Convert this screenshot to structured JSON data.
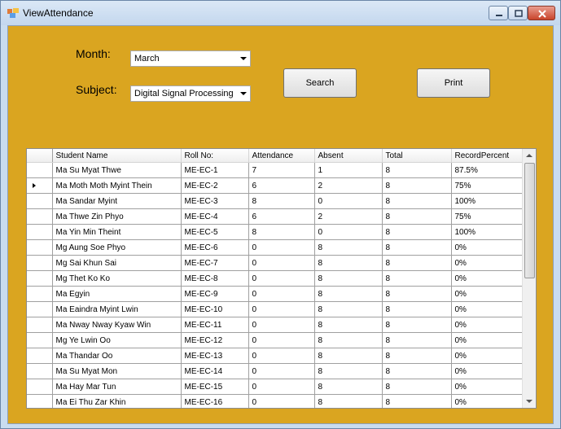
{
  "window": {
    "title": "ViewAttendance"
  },
  "form": {
    "month_label": "Month:",
    "month_value": "March",
    "subject_label": "Subject:",
    "subject_value": "Digital Signal Processing",
    "search_label": "Search",
    "print_label": "Print"
  },
  "grid": {
    "columns": [
      "Student Name",
      "Roll No:",
      "Attendance",
      "Absent",
      "Total",
      "RecordPercent"
    ],
    "rows": [
      [
        "Ma Su Myat Thwe",
        "ME-EC-1",
        "7",
        "1",
        "8",
        "87.5%"
      ],
      [
        "Ma Moth Moth Myint Thein",
        "ME-EC-2",
        "6",
        "2",
        "8",
        "75%"
      ],
      [
        "Ma Sandar Myint",
        "ME-EC-3",
        "8",
        "0",
        "8",
        "100%"
      ],
      [
        "Ma Thwe Zin Phyo",
        "ME-EC-4",
        "6",
        "2",
        "8",
        "75%"
      ],
      [
        "Ma Yin Min Theint",
        "ME-EC-5",
        "8",
        "0",
        "8",
        "100%"
      ],
      [
        "Mg Aung Soe Phyo",
        "ME-EC-6",
        "0",
        "8",
        "8",
        "0%"
      ],
      [
        "Mg Sai Khun Sai",
        "ME-EC-7",
        "0",
        "8",
        "8",
        "0%"
      ],
      [
        "Mg Thet Ko Ko",
        "ME-EC-8",
        "0",
        "8",
        "8",
        "0%"
      ],
      [
        "Ma Egyin",
        "ME-EC-9",
        "0",
        "8",
        "8",
        "0%"
      ],
      [
        "Ma Eaindra Myint Lwin",
        "ME-EC-10",
        "0",
        "8",
        "8",
        "0%"
      ],
      [
        "Ma Nway Nway Kyaw Win",
        "ME-EC-11",
        "0",
        "8",
        "8",
        "0%"
      ],
      [
        "Mg Ye Lwin Oo",
        "ME-EC-12",
        "0",
        "8",
        "8",
        "0%"
      ],
      [
        "Ma Thandar Oo",
        "ME-EC-13",
        "0",
        "8",
        "8",
        "0%"
      ],
      [
        "Ma Su Myat Mon",
        "ME-EC-14",
        "0",
        "8",
        "8",
        "0%"
      ],
      [
        "Ma Hay Mar Tun",
        "ME-EC-15",
        "0",
        "8",
        "8",
        "0%"
      ],
      [
        "Ma Ei Thu Zar Khin",
        "ME-EC-16",
        "0",
        "8",
        "8",
        "0%"
      ]
    ],
    "current_row_index": 1
  },
  "colors": {
    "form_background": "#DAA520",
    "titlebar": "#C9DCEF",
    "close_button": "#C9442B"
  },
  "icons": [
    "app-icon",
    "minimize-icon",
    "maximize-icon",
    "close-icon",
    "dropdown-arrow-icon",
    "current-row-icon",
    "scroll-up-icon",
    "scroll-down-icon"
  ]
}
